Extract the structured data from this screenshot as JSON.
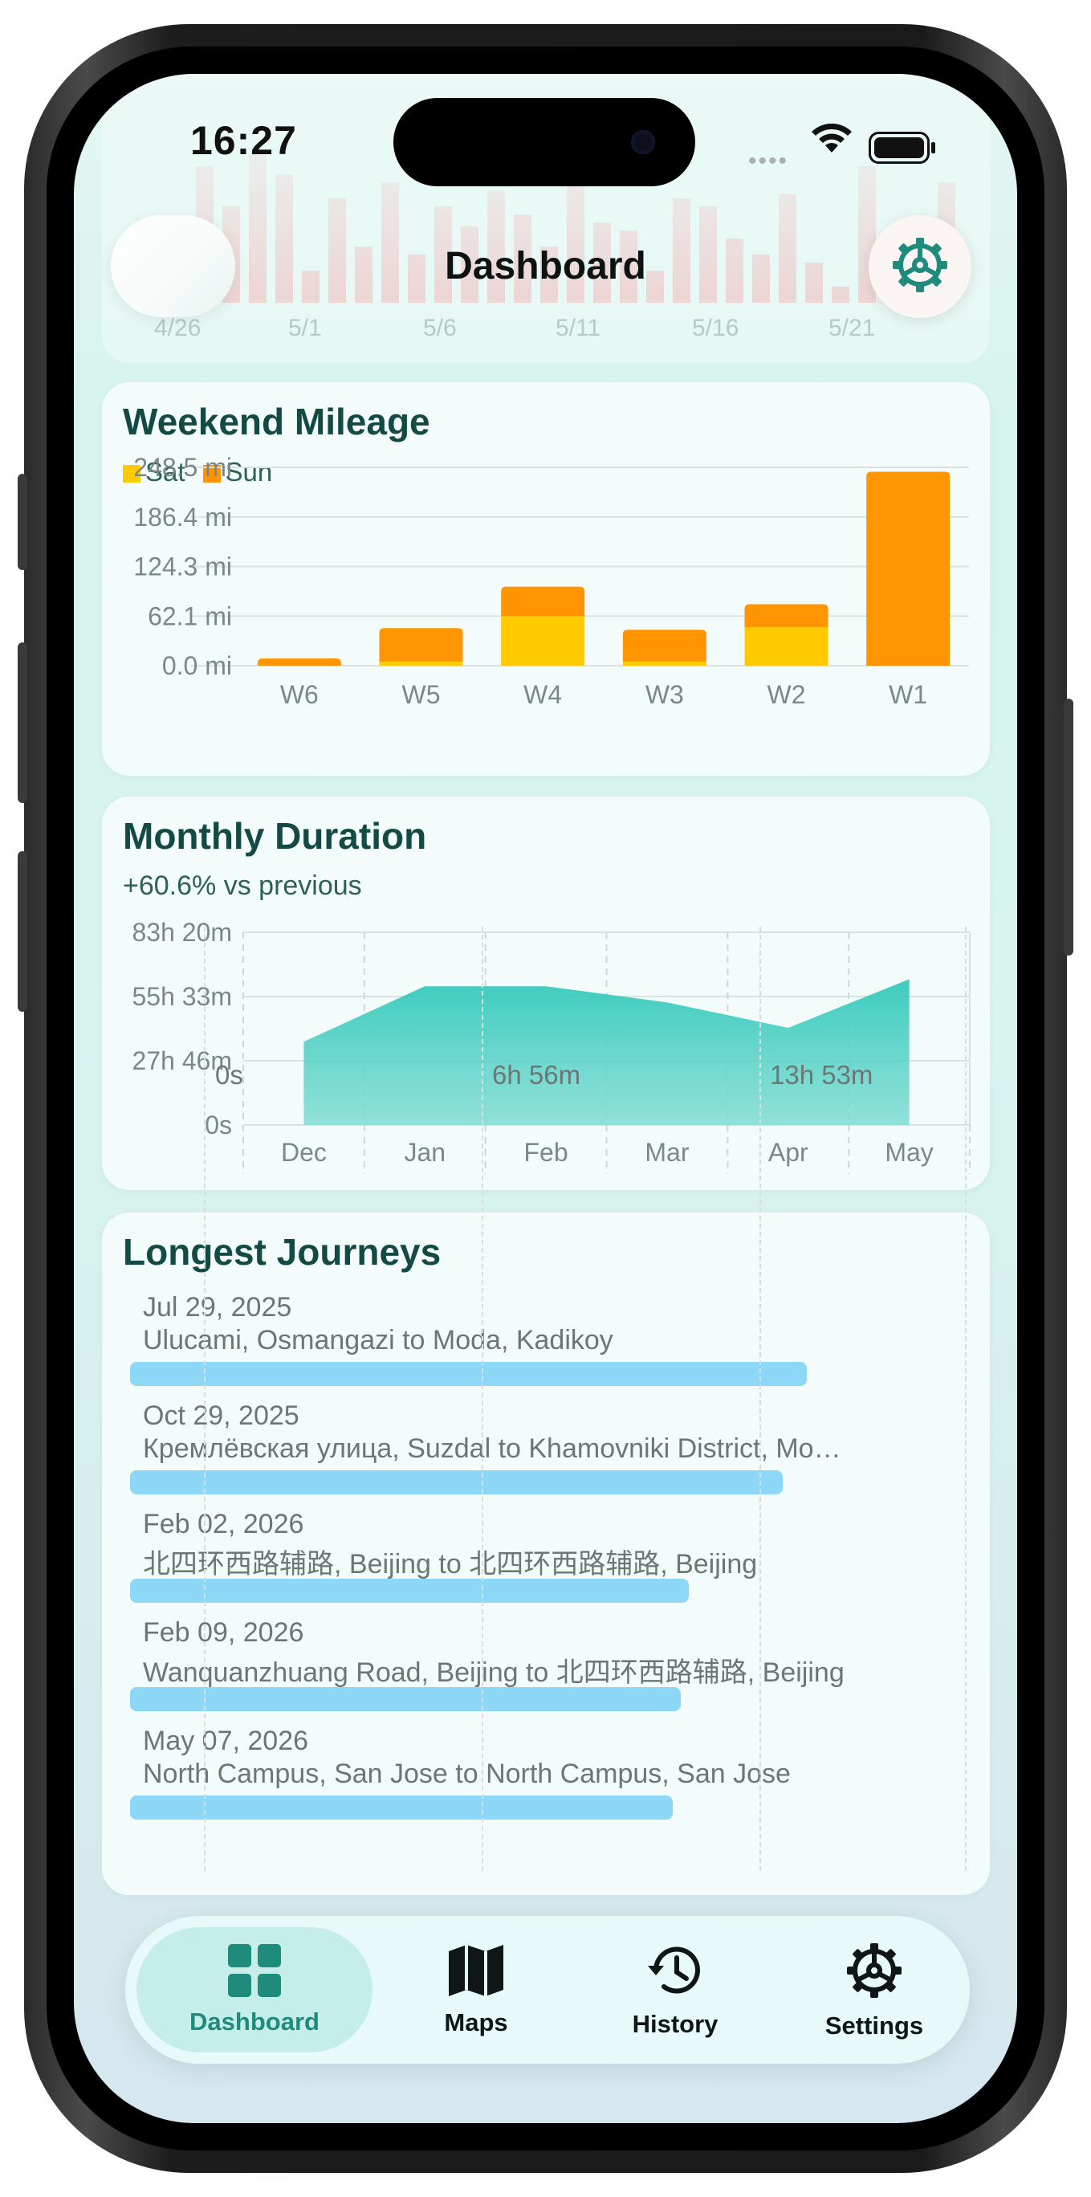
{
  "status_bar": {
    "time": "16:27"
  },
  "header": {
    "title": "Dashboard"
  },
  "top_chart": {
    "tick_labels": [
      "4/26",
      "5/1",
      "5/6",
      "5/11",
      "5/16",
      "5/21"
    ]
  },
  "weekend_mileage": {
    "title": "Weekend Mileage",
    "legend": [
      "Sat",
      "Sun"
    ],
    "y_ticks": [
      "248.5 mi",
      "186.4 mi",
      "124.3 mi",
      "62.1 mi",
      "0.0 mi"
    ]
  },
  "monthly_duration": {
    "title": "Monthly Duration",
    "subtitle": "+60.6% vs previous",
    "y_ticks": [
      "83h 20m",
      "55h 33m",
      "27h 46m",
      "0s"
    ]
  },
  "longest_journeys": {
    "title": "Longest Journeys",
    "items": [
      {
        "date": "Jul 29, 2025",
        "route": "Ulucami, Osmangazi to Moda, Kadikoy",
        "fraction": 0.86
      },
      {
        "date": "Oct 29, 2025",
        "route": "Кремлёвская улица, Suzdal to Khamovniki District, Mo…",
        "fraction": 0.83
      },
      {
        "date": "Feb 02, 2026",
        "route": "北四环西路辅路, Beijing to 北四环西路辅路, Beijing",
        "fraction": 0.71
      },
      {
        "date": "Feb 09, 2026",
        "route": "Wanquanzhuang Road, Beijing to 北四环西路辅路, Beijing",
        "fraction": 0.7
      },
      {
        "date": "May 07, 2026",
        "route": "North Campus, San Jose to North Campus, San Jose",
        "fraction": 0.69
      }
    ],
    "axis_labels": [
      "0s",
      "6h 56m",
      "13h 53m"
    ]
  },
  "tabs": [
    {
      "label": "Dashboard",
      "icon": "grid-icon",
      "active": true
    },
    {
      "label": "Maps",
      "icon": "map-icon",
      "active": false
    },
    {
      "label": "History",
      "icon": "history-icon",
      "active": false
    },
    {
      "label": "Settings",
      "icon": "gear-icon",
      "active": false
    }
  ],
  "colors": {
    "accent": "#1f8b7c",
    "sat": "#ffcb00",
    "sun": "#ff9500",
    "duration_area": "#3dcdc0",
    "journey_bar": "#8dd7f7"
  },
  "chart_data": [
    {
      "type": "bar",
      "title": "Weekend Mileage",
      "categories": [
        "W6",
        "W5",
        "W4",
        "W3",
        "W2",
        "W1"
      ],
      "series": [
        {
          "name": "Sat",
          "values": [
            0,
            5,
            62,
            5,
            48,
            0
          ]
        },
        {
          "name": "Sun",
          "values": [
            9,
            42,
            37,
            40,
            29,
            243
          ]
        }
      ],
      "stacked": true,
      "ylim": [
        0,
        248.5
      ],
      "y_unit": "mi",
      "grid": true,
      "legend": "top-left"
    },
    {
      "type": "area",
      "title": "Monthly Duration",
      "categories": [
        "Dec",
        "Jan",
        "Feb",
        "Mar",
        "Apr",
        "May"
      ],
      "series": [
        {
          "values_hours": [
            36,
            60,
            60,
            53,
            42,
            63
          ]
        }
      ],
      "ylim_hours": [
        0,
        83.33
      ],
      "grid": true
    },
    {
      "type": "bar",
      "orientation": "horizontal",
      "title": "Longest Journeys",
      "categories": [
        "Jul 29, 2025",
        "Oct 29, 2025",
        "Feb 02, 2026",
        "Feb 09, 2026",
        "May 07, 2026"
      ],
      "values_hours": [
        17.9,
        17.3,
        14.8,
        14.6,
        14.4
      ],
      "x_ticks": [
        "0s",
        "6h 56m",
        "13h 53m"
      ]
    }
  ]
}
